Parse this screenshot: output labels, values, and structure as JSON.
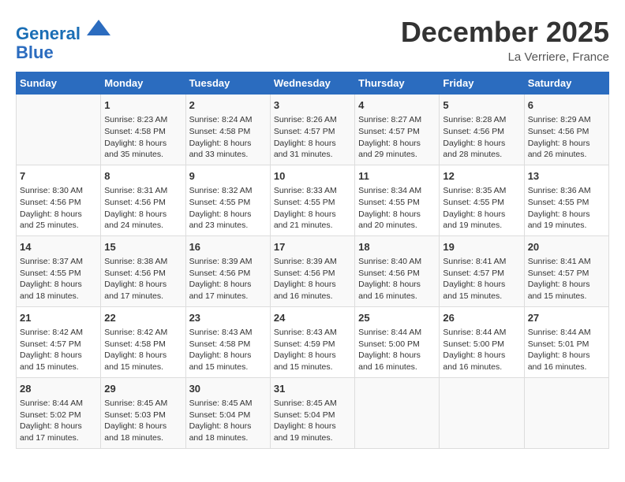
{
  "header": {
    "logo_line1": "General",
    "logo_line2": "Blue",
    "month": "December 2025",
    "location": "La Verriere, France"
  },
  "days_of_week": [
    "Sunday",
    "Monday",
    "Tuesday",
    "Wednesday",
    "Thursday",
    "Friday",
    "Saturday"
  ],
  "weeks": [
    [
      {
        "day": "",
        "info": ""
      },
      {
        "day": "1",
        "info": "Sunrise: 8:23 AM\nSunset: 4:58 PM\nDaylight: 8 hours\nand 35 minutes."
      },
      {
        "day": "2",
        "info": "Sunrise: 8:24 AM\nSunset: 4:58 PM\nDaylight: 8 hours\nand 33 minutes."
      },
      {
        "day": "3",
        "info": "Sunrise: 8:26 AM\nSunset: 4:57 PM\nDaylight: 8 hours\nand 31 minutes."
      },
      {
        "day": "4",
        "info": "Sunrise: 8:27 AM\nSunset: 4:57 PM\nDaylight: 8 hours\nand 29 minutes."
      },
      {
        "day": "5",
        "info": "Sunrise: 8:28 AM\nSunset: 4:56 PM\nDaylight: 8 hours\nand 28 minutes."
      },
      {
        "day": "6",
        "info": "Sunrise: 8:29 AM\nSunset: 4:56 PM\nDaylight: 8 hours\nand 26 minutes."
      }
    ],
    [
      {
        "day": "7",
        "info": "Sunrise: 8:30 AM\nSunset: 4:56 PM\nDaylight: 8 hours\nand 25 minutes."
      },
      {
        "day": "8",
        "info": "Sunrise: 8:31 AM\nSunset: 4:56 PM\nDaylight: 8 hours\nand 24 minutes."
      },
      {
        "day": "9",
        "info": "Sunrise: 8:32 AM\nSunset: 4:55 PM\nDaylight: 8 hours\nand 23 minutes."
      },
      {
        "day": "10",
        "info": "Sunrise: 8:33 AM\nSunset: 4:55 PM\nDaylight: 8 hours\nand 21 minutes."
      },
      {
        "day": "11",
        "info": "Sunrise: 8:34 AM\nSunset: 4:55 PM\nDaylight: 8 hours\nand 20 minutes."
      },
      {
        "day": "12",
        "info": "Sunrise: 8:35 AM\nSunset: 4:55 PM\nDaylight: 8 hours\nand 19 minutes."
      },
      {
        "day": "13",
        "info": "Sunrise: 8:36 AM\nSunset: 4:55 PM\nDaylight: 8 hours\nand 19 minutes."
      }
    ],
    [
      {
        "day": "14",
        "info": "Sunrise: 8:37 AM\nSunset: 4:55 PM\nDaylight: 8 hours\nand 18 minutes."
      },
      {
        "day": "15",
        "info": "Sunrise: 8:38 AM\nSunset: 4:56 PM\nDaylight: 8 hours\nand 17 minutes."
      },
      {
        "day": "16",
        "info": "Sunrise: 8:39 AM\nSunset: 4:56 PM\nDaylight: 8 hours\nand 17 minutes."
      },
      {
        "day": "17",
        "info": "Sunrise: 8:39 AM\nSunset: 4:56 PM\nDaylight: 8 hours\nand 16 minutes."
      },
      {
        "day": "18",
        "info": "Sunrise: 8:40 AM\nSunset: 4:56 PM\nDaylight: 8 hours\nand 16 minutes."
      },
      {
        "day": "19",
        "info": "Sunrise: 8:41 AM\nSunset: 4:57 PM\nDaylight: 8 hours\nand 15 minutes."
      },
      {
        "day": "20",
        "info": "Sunrise: 8:41 AM\nSunset: 4:57 PM\nDaylight: 8 hours\nand 15 minutes."
      }
    ],
    [
      {
        "day": "21",
        "info": "Sunrise: 8:42 AM\nSunset: 4:57 PM\nDaylight: 8 hours\nand 15 minutes."
      },
      {
        "day": "22",
        "info": "Sunrise: 8:42 AM\nSunset: 4:58 PM\nDaylight: 8 hours\nand 15 minutes."
      },
      {
        "day": "23",
        "info": "Sunrise: 8:43 AM\nSunset: 4:58 PM\nDaylight: 8 hours\nand 15 minutes."
      },
      {
        "day": "24",
        "info": "Sunrise: 8:43 AM\nSunset: 4:59 PM\nDaylight: 8 hours\nand 15 minutes."
      },
      {
        "day": "25",
        "info": "Sunrise: 8:44 AM\nSunset: 5:00 PM\nDaylight: 8 hours\nand 16 minutes."
      },
      {
        "day": "26",
        "info": "Sunrise: 8:44 AM\nSunset: 5:00 PM\nDaylight: 8 hours\nand 16 minutes."
      },
      {
        "day": "27",
        "info": "Sunrise: 8:44 AM\nSunset: 5:01 PM\nDaylight: 8 hours\nand 16 minutes."
      }
    ],
    [
      {
        "day": "28",
        "info": "Sunrise: 8:44 AM\nSunset: 5:02 PM\nDaylight: 8 hours\nand 17 minutes."
      },
      {
        "day": "29",
        "info": "Sunrise: 8:45 AM\nSunset: 5:03 PM\nDaylight: 8 hours\nand 18 minutes."
      },
      {
        "day": "30",
        "info": "Sunrise: 8:45 AM\nSunset: 5:04 PM\nDaylight: 8 hours\nand 18 minutes."
      },
      {
        "day": "31",
        "info": "Sunrise: 8:45 AM\nSunset: 5:04 PM\nDaylight: 8 hours\nand 19 minutes."
      },
      {
        "day": "",
        "info": ""
      },
      {
        "day": "",
        "info": ""
      },
      {
        "day": "",
        "info": ""
      }
    ]
  ]
}
